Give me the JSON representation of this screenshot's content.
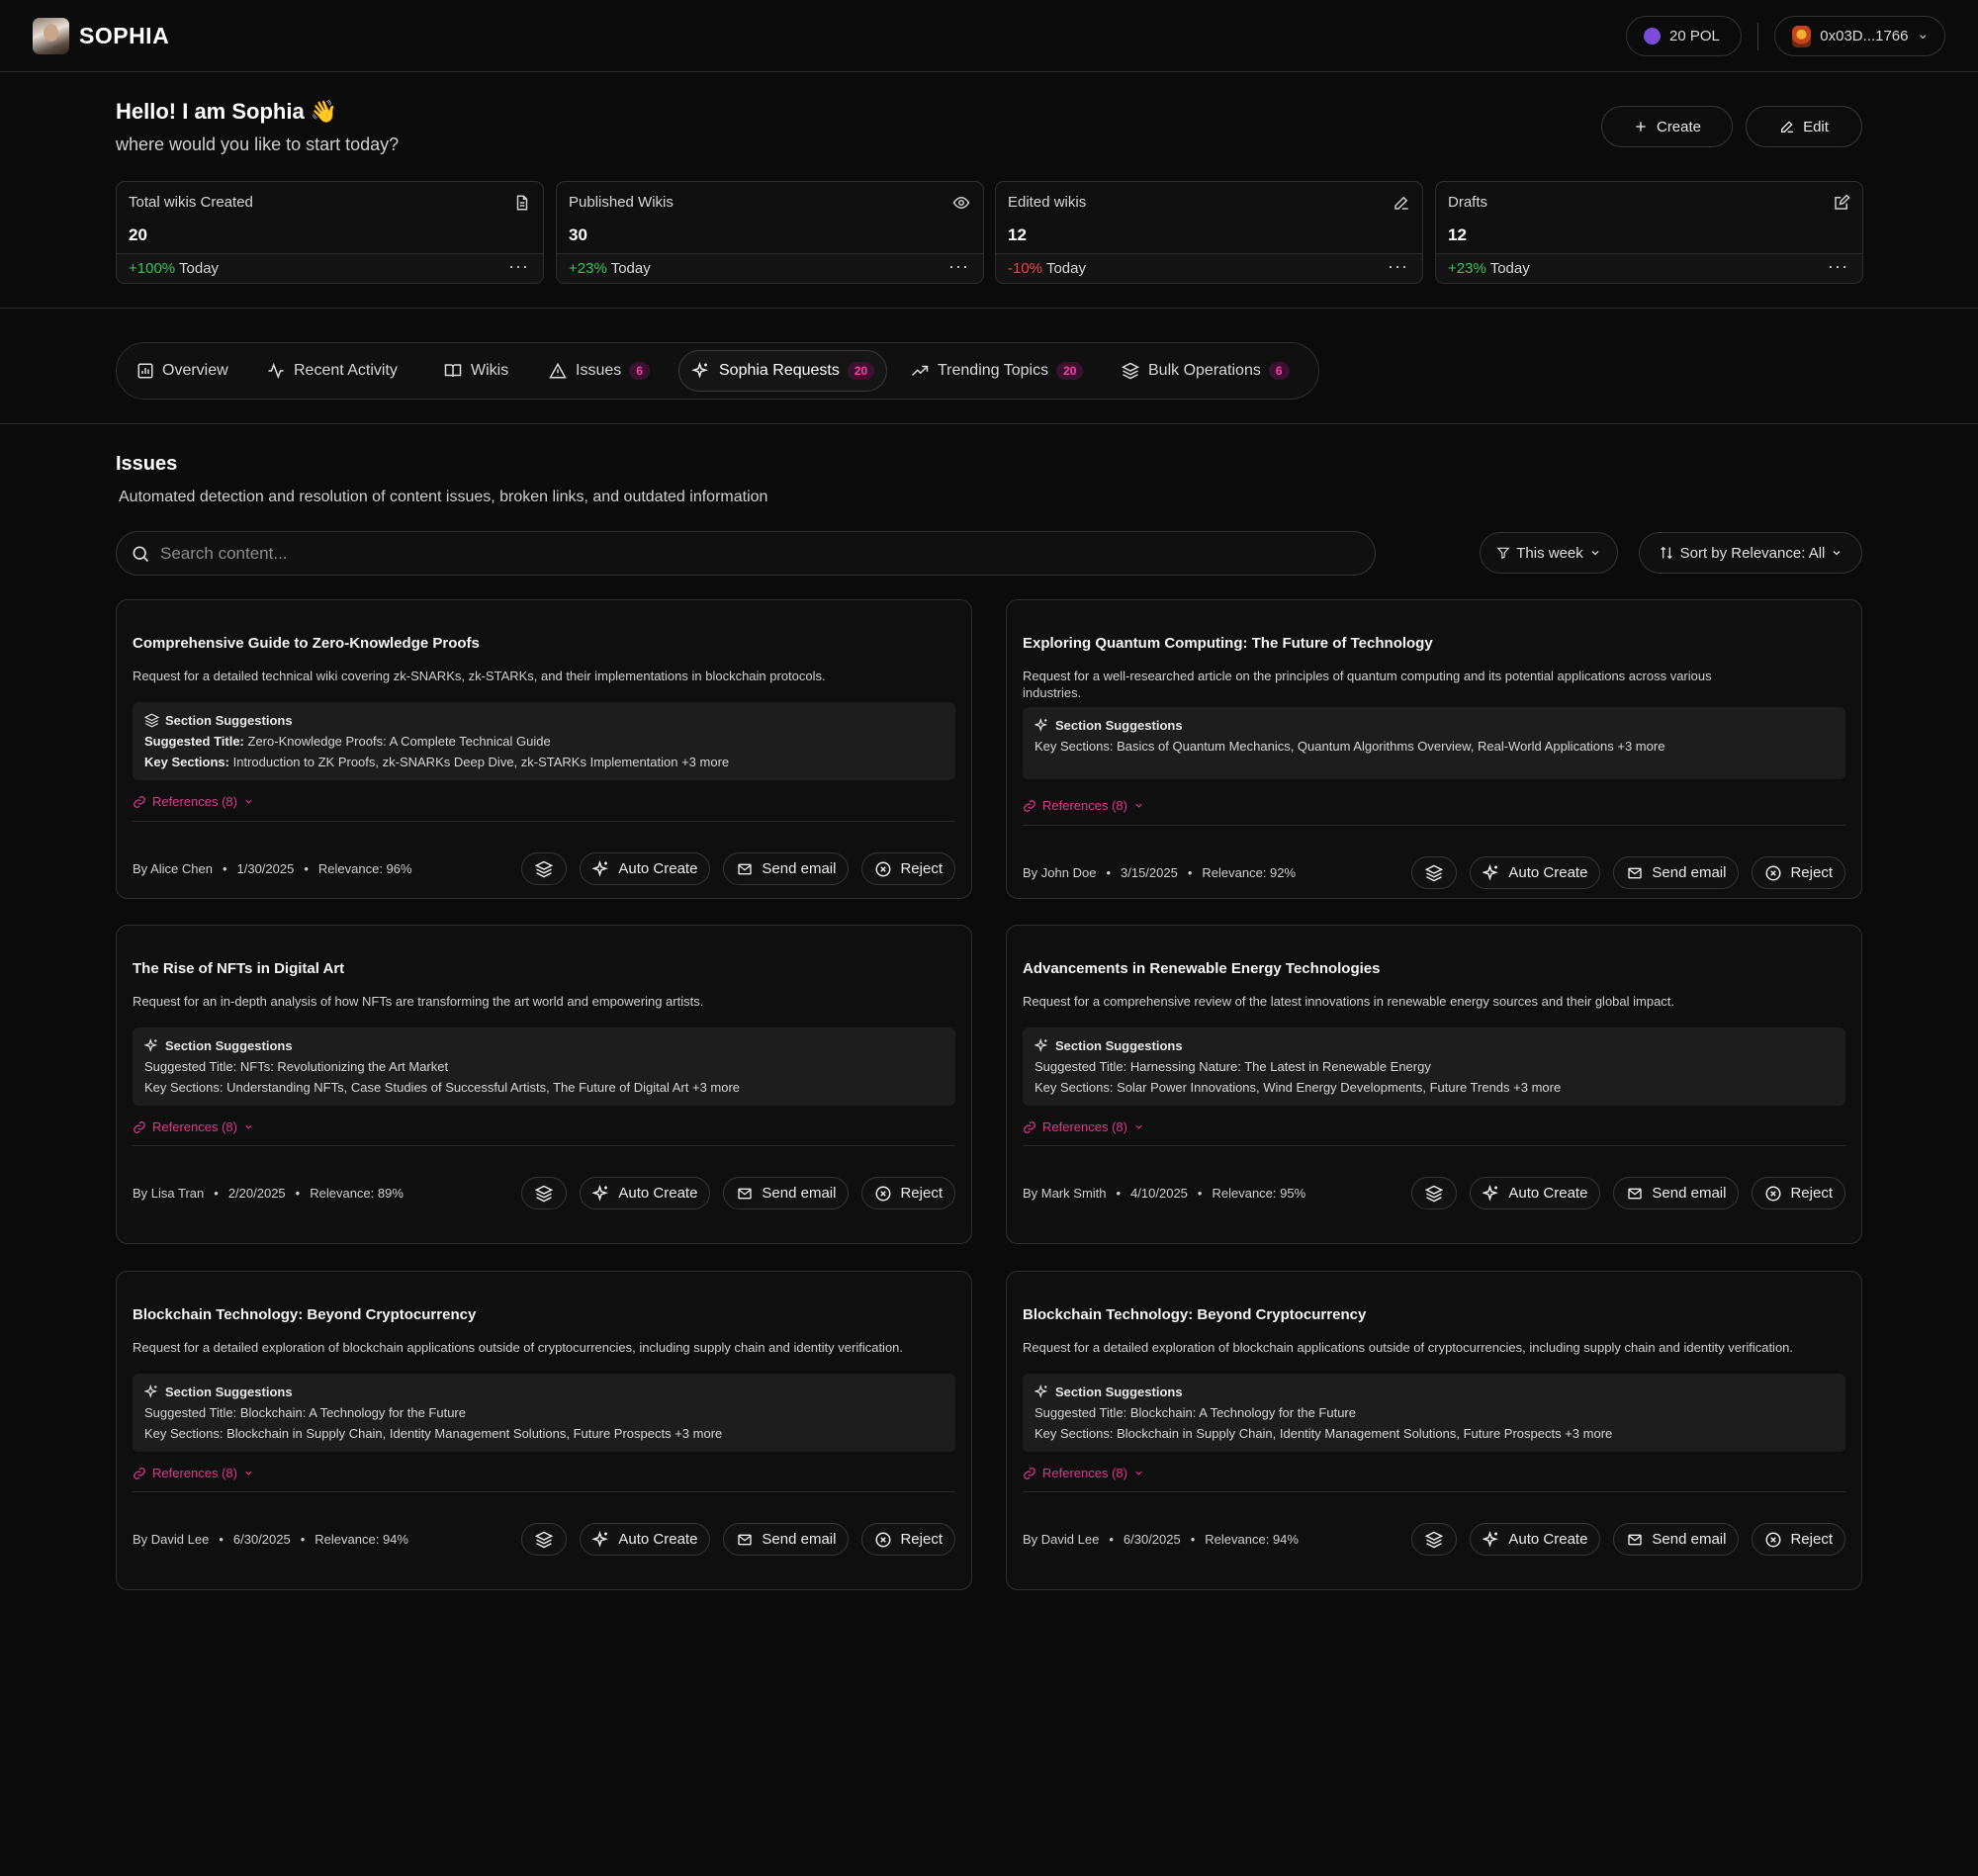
{
  "app": {
    "name": "SOPHIA"
  },
  "topbar": {
    "balance": "20 POL",
    "wallet": "0x03D...1766"
  },
  "greeting": {
    "title": "Hello! I am Sophia 👋",
    "subtitle": "where would you like to start today?"
  },
  "actions": {
    "create": "Create",
    "edit": "Edit"
  },
  "stats": [
    {
      "title": "Total wikis Created",
      "value": "20",
      "change": "+100%",
      "period": "Today",
      "trend": "up"
    },
    {
      "title": "Published Wikis",
      "value": "30",
      "change": "+23%",
      "period": "Today",
      "trend": "up"
    },
    {
      "title": "Edited wikis",
      "value": "12",
      "change": "-10%",
      "period": "Today",
      "trend": "down"
    },
    {
      "title": "Drafts",
      "value": "12",
      "change": "+23%",
      "period": "Today",
      "trend": "up"
    }
  ],
  "tabs": [
    {
      "label": "Overview"
    },
    {
      "label": "Recent Activity"
    },
    {
      "label": "Wikis"
    },
    {
      "label": "Issues",
      "badge": "6"
    },
    {
      "label": "Sophia Requests",
      "badge": "20",
      "active": true
    },
    {
      "label": "Trending Topics",
      "badge": "20"
    },
    {
      "label": "Bulk Operations",
      "badge": "6"
    }
  ],
  "section": {
    "title": "Issues",
    "subtitle": "Automated detection and resolution of content issues, broken links, and outdated information"
  },
  "search": {
    "placeholder": "Search content..."
  },
  "filters": {
    "period": "This week",
    "sort": "Sort by Relevance: All"
  },
  "card_labels": {
    "section_suggestions": "Section Suggestions",
    "suggested_title_prefix": "Suggested Title:",
    "key_sections_prefix": "Key Sections:",
    "references": "References (8)",
    "auto_create": "Auto Create",
    "send_email": "Send email",
    "reject": "Reject"
  },
  "cards": [
    {
      "title": "Comprehensive Guide to Zero-Knowledge Proofs",
      "description": "Request for a detailed technical wiki covering zk-SNARKs, zk-STARKs, and their implementations in blockchain protocols.",
      "suggested_title": "Zero-Knowledge Proofs: A Complete Technical Guide",
      "key_sections": "Introduction to ZK Proofs, zk-SNARKs Deep Dive, zk-STARKs Implementation +3 more",
      "author": "By Alice Chen",
      "date": "1/30/2025",
      "relevance": "Relevance: 96%"
    },
    {
      "title": "Exploring Quantum Computing: The Future of Technology",
      "description": "Request for a well-researched article on the principles of quantum computing and its potential applications across various industries.",
      "key_sections": "Basics of Quantum Mechanics, Quantum Algorithms Overview, Real-World Applications +3 more",
      "author": "By John Doe",
      "date": "3/15/2025",
      "relevance": "Relevance: 92%"
    },
    {
      "title": "The Rise of NFTs in Digital Art",
      "description": "Request for an in-depth analysis of how NFTs are transforming the art world and empowering artists.",
      "suggested_title": "NFTs: Revolutionizing the Art Market",
      "key_sections": "Understanding NFTs, Case Studies of Successful Artists, The Future of Digital Art +3 more",
      "author": "By Lisa Tran",
      "date": "2/20/2025",
      "relevance": "Relevance: 89%"
    },
    {
      "title": "Advancements in Renewable Energy Technologies",
      "description": "Request for a comprehensive review of the latest innovations in renewable energy sources and their global impact.",
      "suggested_title": "Harnessing Nature: The Latest in Renewable Energy",
      "key_sections": "Solar Power Innovations, Wind Energy Developments, Future Trends +3 more",
      "author": "By Mark Smith",
      "date": "4/10/2025",
      "relevance": "Relevance: 95%"
    },
    {
      "title": "Blockchain Technology: Beyond Cryptocurrency",
      "description": "Request for a detailed exploration of blockchain applications outside of cryptocurrencies, including supply chain and identity verification.",
      "suggested_title": "Blockchain: A Technology for the Future",
      "key_sections": "Blockchain in Supply Chain, Identity Management Solutions, Future Prospects +3 more",
      "author": "By David Lee",
      "date": "6/30/2025",
      "relevance": "Relevance: 94%"
    },
    {
      "title": "Blockchain Technology: Beyond Cryptocurrency",
      "description": "Request for a detailed exploration of blockchain applications outside of cryptocurrencies, including supply chain and identity verification.",
      "suggested_title": "Blockchain: A Technology for the Future",
      "key_sections": "Blockchain in Supply Chain, Identity Management Solutions, Future Prospects +3 more",
      "author": "By David Lee",
      "date": "6/30/2025",
      "relevance": "Relevance: 94%"
    }
  ],
  "colors": {
    "accent_pink": "#e0388f",
    "positive": "#34c759",
    "negative": "#ef4444",
    "background": "#0b0b0b"
  },
  "icons": [
    "file-icon",
    "eye-icon",
    "pencil-icon",
    "edit-square-icon",
    "bar-chart-icon",
    "activity-icon",
    "book-icon",
    "warning-icon",
    "sparkles-icon",
    "trending-up-icon",
    "layers-icon",
    "search-icon",
    "filter-icon",
    "sort-icon",
    "link-icon",
    "mail-icon",
    "x-circle-icon",
    "plus-icon",
    "chevron-down-icon"
  ]
}
